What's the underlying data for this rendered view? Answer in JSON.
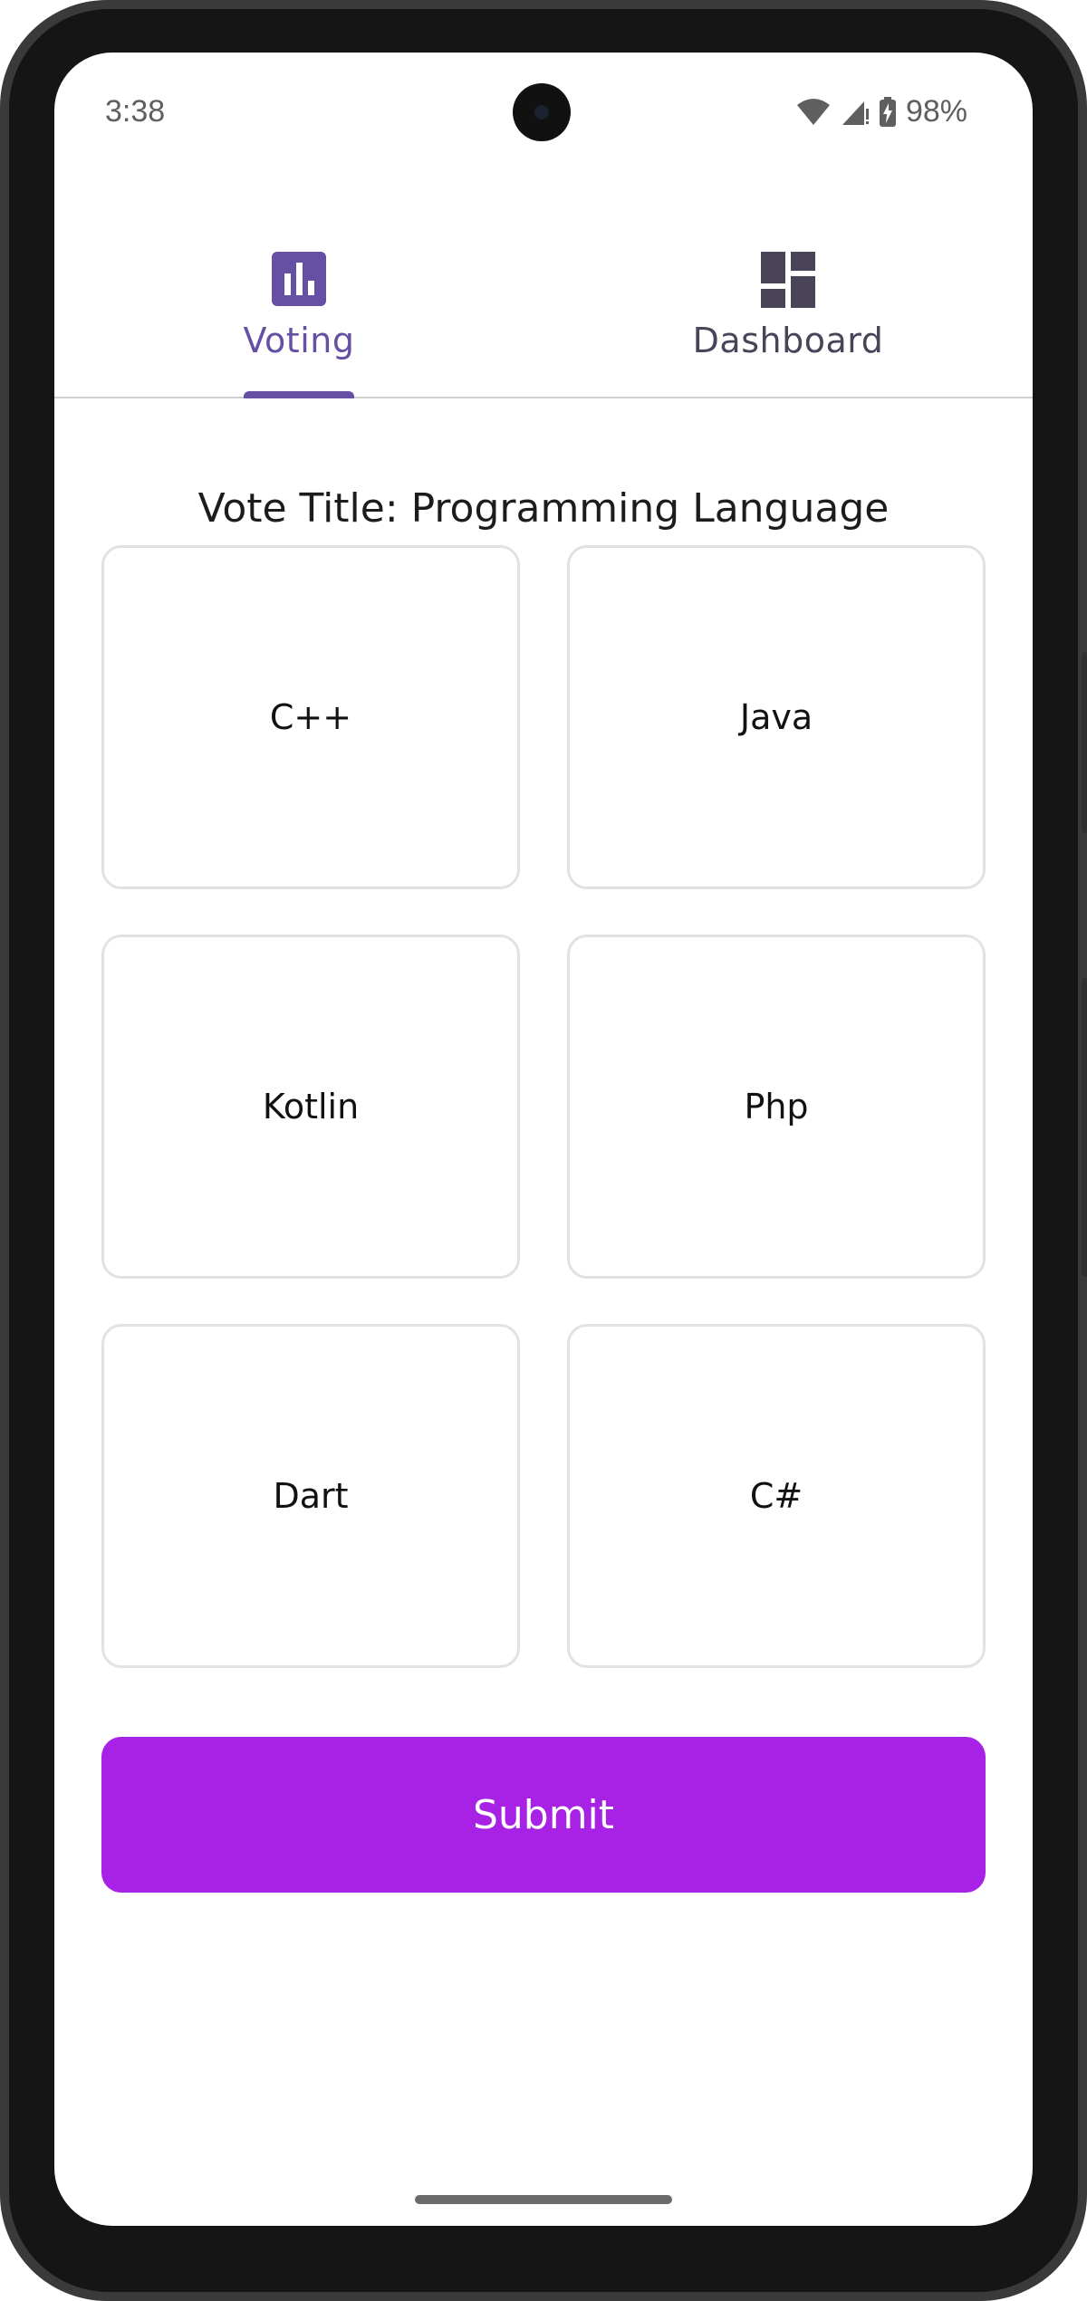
{
  "status_bar": {
    "time": "3:38",
    "battery_percent": "98%",
    "icons": [
      "wifi-icon",
      "cell-signal-icon",
      "battery-charging-icon"
    ]
  },
  "tabs": [
    {
      "label": "Voting",
      "icon": "bar-chart-icon",
      "active": true
    },
    {
      "label": "Dashboard",
      "icon": "dashboard-icon",
      "active": false
    }
  ],
  "vote": {
    "title": "Vote Title: Programming Language",
    "options": [
      "C++",
      "Java",
      "Kotlin",
      "Php",
      "Dart",
      "C#"
    ]
  },
  "submit": {
    "label": "Submit"
  },
  "colors": {
    "accent": "#6650a4",
    "submit_background": "#a822e6",
    "card_border": "#e2e2e2"
  }
}
